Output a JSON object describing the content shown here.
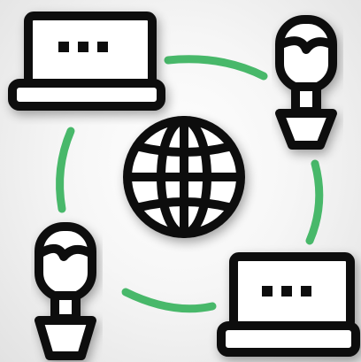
{
  "illustration": {
    "colors": {
      "outline": "#101010",
      "connector": "#48b86a",
      "fill": "#ffffff",
      "background": "#f1f1f1"
    },
    "icons": [
      "laptop-icon",
      "person-icon",
      "globe-icon",
      "person-icon",
      "laptop-icon"
    ]
  }
}
